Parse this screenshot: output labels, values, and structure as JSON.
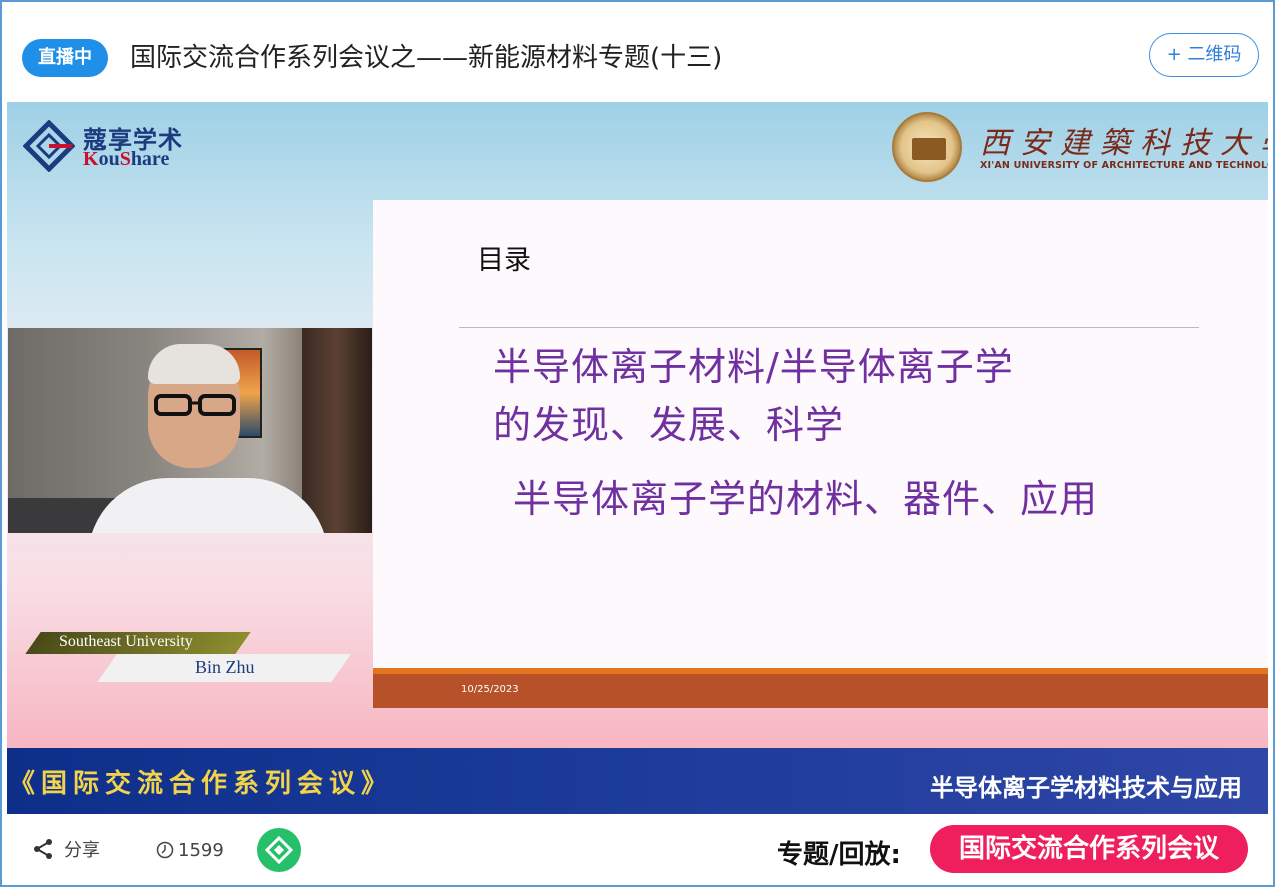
{
  "header": {
    "live_badge": "直播中",
    "title": "国际交流合作系列会议之——新能源材料专题(十三)",
    "qr_button": "+ 二维码"
  },
  "stage": {
    "kou_logo_cn": "蔻享学术",
    "kou_logo_en_k": "K",
    "kou_logo_en_ou": "ou",
    "kou_logo_en_s": "S",
    "kou_logo_en_hare": "hare",
    "xauat_logo_cn": "西安建築科技大學",
    "xauat_logo_en": "XI'AN UNIVERSITY OF ARCHITECTURE AND TECHNOLOGY",
    "speaker_university": "Southeast University",
    "speaker_name": "Bin Zhu"
  },
  "slide": {
    "heading": "目录",
    "line1": "半导体离子材料/半导体离子学",
    "line2": "的发现、发展、科学",
    "line3": "半导体离子学的材料、器件、应用",
    "date": "10/25/2023",
    "text_color": "#7030a0",
    "footer_color": "#b6512a"
  },
  "banner": {
    "left": "《国际交流合作系列会议》",
    "right": "半导体离子学材料技术与应用"
  },
  "bottom": {
    "share_label": "分享",
    "views": "1599",
    "topic_label": "专题/回放:",
    "topic_pill": "国际交流合作系列会议",
    "accent_color": "#ee1f5c"
  },
  "icons": [
    "share-icon",
    "clock-icon",
    "koushare-app-icon"
  ]
}
